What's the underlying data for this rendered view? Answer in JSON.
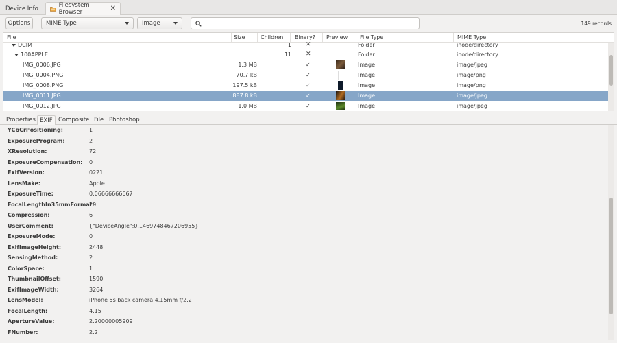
{
  "tabs": [
    {
      "label": "Device Info",
      "active": false
    },
    {
      "label": "Filesystem Browser",
      "active": true
    }
  ],
  "toolbar": {
    "options_label": "Options",
    "mime_select": "MIME Type",
    "image_select": "Image",
    "search_placeholder": "",
    "records": "149 records"
  },
  "table": {
    "columns": [
      "File",
      "Size",
      "Children",
      "Binary?",
      "Preview",
      "File Type",
      "MIME Type"
    ],
    "rows": [
      {
        "file": "DCIM",
        "indent": 1,
        "expanded": true,
        "size": "",
        "children": "1",
        "binary": "cross",
        "preview": "",
        "type": "Folder",
        "mime": "inode/directory",
        "selected": false
      },
      {
        "file": "100APPLE",
        "indent": 2,
        "expanded": true,
        "size": "",
        "children": "11",
        "binary": "cross",
        "preview": "",
        "type": "Folder",
        "mime": "inode/directory",
        "selected": false
      },
      {
        "file": "IMG_0006.JPG",
        "indent": 3,
        "size": "1.3 MB",
        "children": "",
        "binary": "check",
        "preview": "dark-photo",
        "type": "Image",
        "mime": "image/jpeg",
        "selected": false
      },
      {
        "file": "IMG_0004.PNG",
        "indent": 3,
        "size": "70.7 kB",
        "children": "",
        "binary": "check",
        "preview": "white",
        "type": "Image",
        "mime": "image/png",
        "selected": false
      },
      {
        "file": "IMG_0008.PNG",
        "indent": 3,
        "size": "197.5 kB",
        "children": "",
        "binary": "check",
        "preview": "navy",
        "type": "Image",
        "mime": "image/png",
        "selected": false
      },
      {
        "file": "IMG_0011.JPG",
        "indent": 3,
        "size": "887.8 kB",
        "children": "",
        "binary": "check",
        "preview": "dark-orange",
        "type": "Image",
        "mime": "image/jpeg",
        "selected": true
      },
      {
        "file": "IMG_0012.JPG",
        "indent": 3,
        "size": "1.0 MB",
        "children": "",
        "binary": "check",
        "preview": "green",
        "type": "Image",
        "mime": "image/jpeg",
        "selected": false
      }
    ]
  },
  "subtabs": [
    {
      "label": "Properties",
      "active": false
    },
    {
      "label": "EXIF",
      "active": true
    },
    {
      "label": "Composite",
      "active": false
    },
    {
      "label": "File",
      "active": false
    },
    {
      "label": "Photoshop",
      "active": false
    }
  ],
  "exif": [
    {
      "key": "YCbCrPositioning:",
      "value": "1"
    },
    {
      "key": "ExposureProgram:",
      "value": "2"
    },
    {
      "key": "XResolution:",
      "value": "72"
    },
    {
      "key": "ExposureCompensation:",
      "value": "0"
    },
    {
      "key": "ExifVersion:",
      "value": "0221"
    },
    {
      "key": "LensMake:",
      "value": "Apple"
    },
    {
      "key": "ExposureTime:",
      "value": "0.06666666667"
    },
    {
      "key": "FocalLengthIn35mmFormat:",
      "value": "29"
    },
    {
      "key": "Compression:",
      "value": "6"
    },
    {
      "key": "UserComment:",
      "value": "{\"DeviceAngle\":0.1469748467206955}"
    },
    {
      "key": "ExposureMode:",
      "value": "0"
    },
    {
      "key": "ExifImageHeight:",
      "value": "2448"
    },
    {
      "key": "SensingMethod:",
      "value": "2"
    },
    {
      "key": "ColorSpace:",
      "value": "1"
    },
    {
      "key": "ThumbnailOffset:",
      "value": "1590"
    },
    {
      "key": "ExifImageWidth:",
      "value": "3264"
    },
    {
      "key": "LensModel:",
      "value": "iPhone 5s back camera 4.15mm f/2.2"
    },
    {
      "key": "FocalLength:",
      "value": "4.15"
    },
    {
      "key": "ApertureValue:",
      "value": "2.20000005909"
    },
    {
      "key": "FNumber:",
      "value": "2.2"
    }
  ],
  "colors": {
    "selected_row": "#86a6c8",
    "window_bg": "#f2f1f0",
    "folder_icon": "#e8a33c"
  }
}
